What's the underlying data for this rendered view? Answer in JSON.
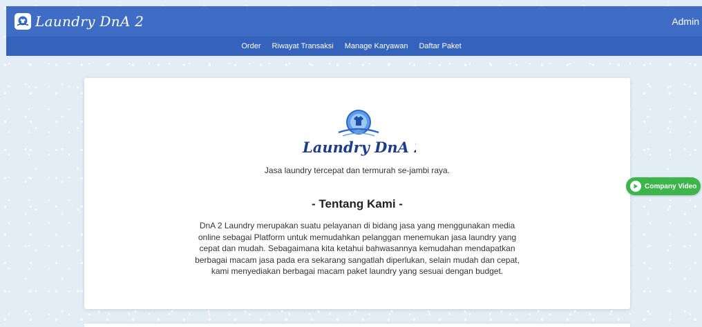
{
  "header": {
    "brand_name": "Laundry DnA 2",
    "user_label": "Admin"
  },
  "nav": {
    "items": [
      {
        "label": "Order"
      },
      {
        "label": "Riwayat Transaksi"
      },
      {
        "label": "Manage Karyawan"
      },
      {
        "label": "Daftar Paket"
      }
    ]
  },
  "hero": {
    "logo_text": "Laundry DnA 2",
    "tagline": "Jasa laundry tercepat dan termurah se-jambi raya."
  },
  "about": {
    "title": "- Tentang Kami -",
    "text": "DnA 2 Laundry merupakan suatu pelayanan di bidang jasa yang menggunakan media online sebagai Platform untuk memudahkan pelanggan menemukan jasa laundry yang cepat dan mudah. Sebagaimana kita ketahui bahwasannya kemudahan mendapatkan berbagai macam jasa pada era sekarang sangatlah diperlukan, selain mudah dan cepat, kami menyediakan berbagai macam paket laundry yang sesuai dengan budget."
  },
  "video_button": {
    "label": "Company Video"
  },
  "colors": {
    "header_bg": "#3f6cc5",
    "nav_bg": "#3563bb",
    "video_button": "#3db54a",
    "page_bg": "#e3edf6"
  },
  "icons": {
    "brand": "laundry-logo-icon",
    "play": "play-icon"
  }
}
